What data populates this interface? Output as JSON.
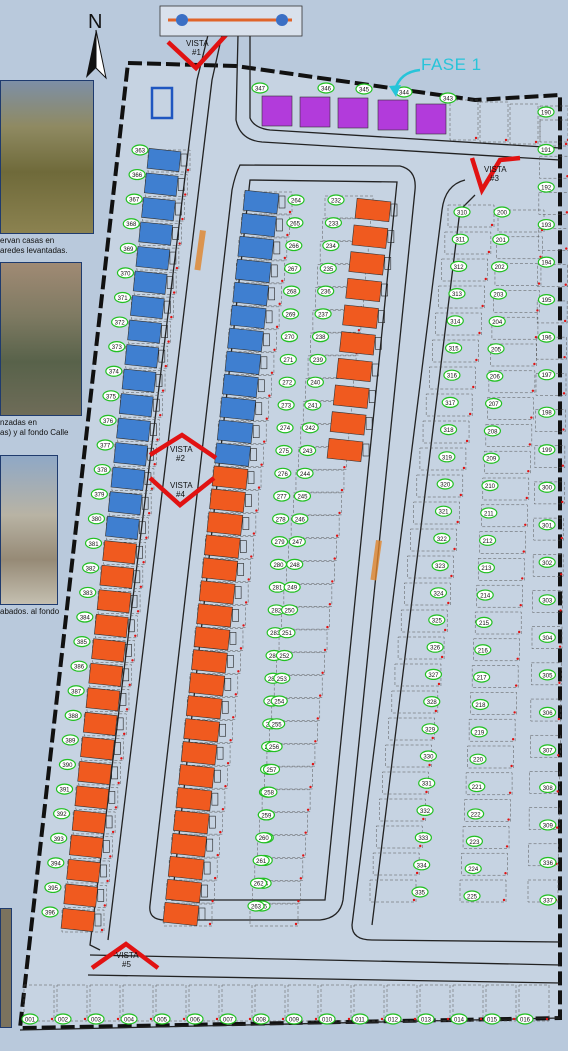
{
  "compass": {
    "label": "N"
  },
  "fase": {
    "label": "FASE 1"
  },
  "captions": {
    "cap1": [
      "ervan casas en",
      "aredes levantadas."
    ],
    "cap2": [
      "nzadas en",
      "as) y al fondo Calle"
    ],
    "cap3": [
      "abados. al fondo"
    ]
  },
  "views": [
    {
      "word": "VISTA",
      "num": "#1"
    },
    {
      "word": "VISTA",
      "num": "#2"
    },
    {
      "word": "VISTA",
      "num": "#3"
    },
    {
      "word": "VISTA",
      "num": "#4"
    },
    {
      "word": "VISTA",
      "num": "#5"
    }
  ],
  "colors": {
    "background": "#b9c9dc",
    "blue_lot": "#3f7fd0",
    "orange_lot": "#f05a1f",
    "purple_lot": "#b23bdb",
    "lot_number": "#22c022",
    "arrow_red": "#e11212",
    "fase_text": "#27c4d9"
  },
  "lot_numbers": {
    "purple_row": [
      "347",
      "346",
      "345",
      "344",
      "343"
    ],
    "left_strip": [
      "363",
      "366",
      "367",
      "368",
      "369",
      "370",
      "371",
      "372",
      "373",
      "374",
      "375",
      "376",
      "377",
      "378",
      "379",
      "380",
      "381",
      "382",
      "383",
      "384",
      "385",
      "386",
      "387",
      "388",
      "389",
      "390",
      "391",
      "392",
      "393",
      "394",
      "395",
      "396"
    ],
    "mid_a": [
      "264",
      "265",
      "266",
      "267",
      "268",
      "269",
      "270",
      "271",
      "272",
      "273",
      "274",
      "275",
      "276",
      "277",
      "278",
      "279",
      "280",
      "281",
      "282",
      "283",
      "284",
      "285",
      "286",
      "287",
      "288",
      "289",
      "290",
      "291",
      "292",
      "293",
      "294",
      "295"
    ],
    "mid_b": [
      "232",
      "233",
      "234",
      "235",
      "236",
      "237",
      "238",
      "239",
      "240",
      "241",
      "242",
      "243",
      "244",
      "245",
      "246",
      "247",
      "248",
      "249",
      "250",
      "251",
      "252",
      "253",
      "254",
      "255",
      "256",
      "257",
      "258",
      "259",
      "260",
      "261",
      "262",
      "263"
    ],
    "right_a": [
      "200",
      "201",
      "202",
      "203",
      "204",
      "205",
      "206",
      "207",
      "208",
      "209",
      "210",
      "211",
      "212",
      "213",
      "214",
      "215",
      "216",
      "217",
      "218",
      "219",
      "220",
      "221",
      "222",
      "223",
      "224",
      "225"
    ],
    "right_b": [
      "310",
      "311",
      "312",
      "313",
      "314",
      "315",
      "316",
      "317",
      "318",
      "319",
      "320",
      "321",
      "322",
      "323",
      "324",
      "325",
      "326",
      "327",
      "328",
      "329",
      "330",
      "331",
      "332",
      "333",
      "334",
      "335"
    ],
    "far_right": [
      "190",
      "191",
      "192",
      "193",
      "194",
      "195",
      "196",
      "197",
      "198",
      "199",
      "300",
      "301",
      "302",
      "303",
      "304",
      "305",
      "306",
      "307",
      "308",
      "309",
      "336",
      "337"
    ],
    "bottom_row": [
      "001",
      "002",
      "003",
      "004",
      "005",
      "006",
      "007",
      "008",
      "009",
      "010",
      "011",
      "012",
      "013",
      "014",
      "015",
      "016"
    ]
  }
}
